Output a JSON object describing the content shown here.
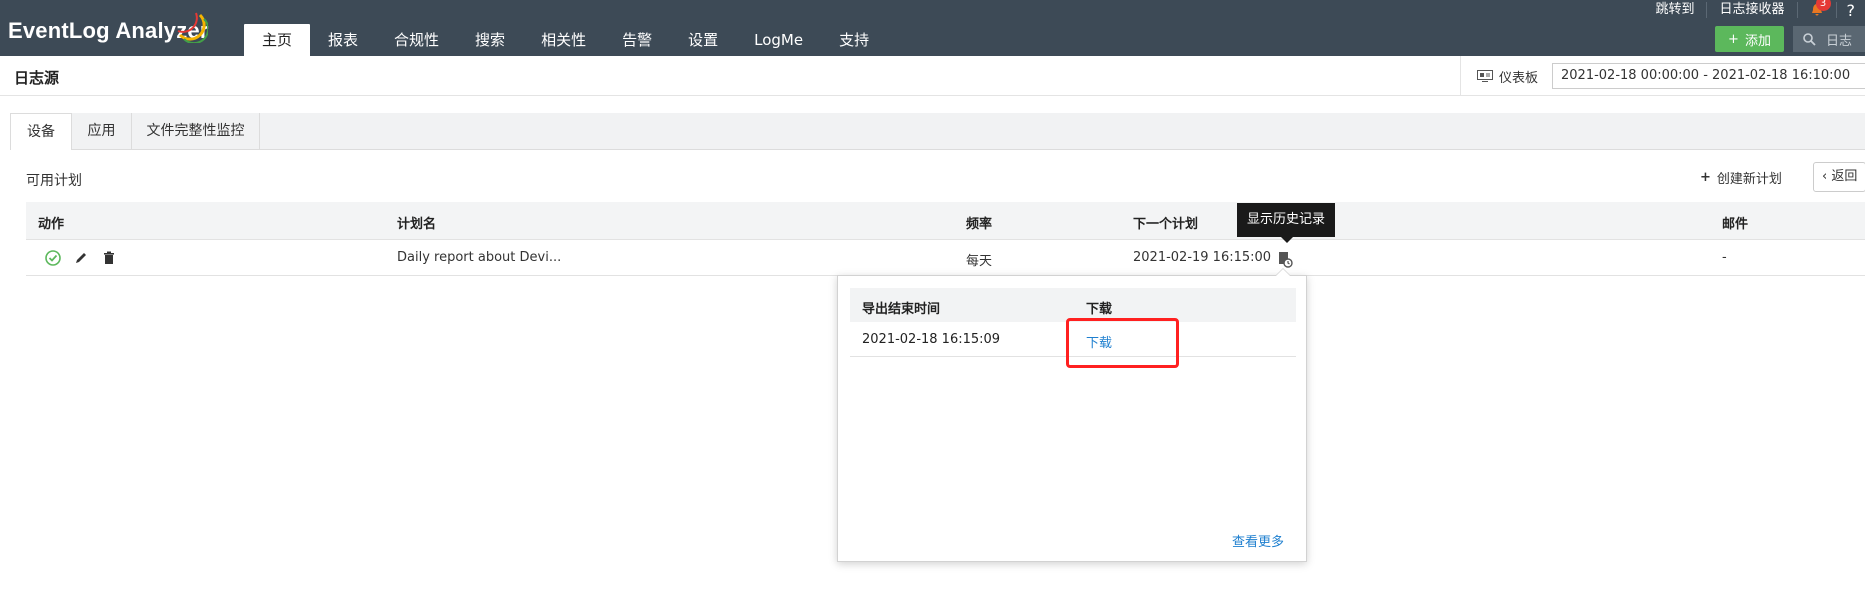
{
  "app": {
    "logo_text": "EventLog Analyzer",
    "nav": [
      "主页",
      "报表",
      "合规性",
      "搜索",
      "相关性",
      "告警",
      "设置",
      "LogMe",
      "支持"
    ],
    "active_nav": "主页",
    "top_links": {
      "jump_to": "跳转到",
      "log_receiver": "日志接收器",
      "notification_count": "3",
      "help": "?"
    },
    "add_label": "添加",
    "search_placeholder": "日志"
  },
  "subheader": {
    "title": "日志源",
    "dashboard": "仪表板",
    "date_range": "2021-02-18 00:00:00 - 2021-02-18 16:10:00"
  },
  "tabs": [
    "设备",
    "应用",
    "文件完整性监控"
  ],
  "content": {
    "available_plans": "可用计划",
    "create_plan": "创建新计划",
    "back": "返回"
  },
  "table": {
    "headers": {
      "action": "动作",
      "plan_name": "计划名",
      "frequency": "频率",
      "next_schedule": "下一个计划",
      "email": "邮件"
    },
    "rows": [
      {
        "plan_name": "Daily report about Devi...",
        "frequency": "每天",
        "next_schedule": "2021-02-19 16:15:00",
        "email": "-"
      }
    ]
  },
  "tooltip": "显示历史记录",
  "history_popup": {
    "headers": {
      "export_end_time": "导出结束时间",
      "download": "下载"
    },
    "rows": [
      {
        "export_end_time": "2021-02-18 16:15:09",
        "download": "下载"
      }
    ],
    "view_more": "查看更多"
  },
  "colors": {
    "topbar": "#3d4a56",
    "add_button": "#5cb85c",
    "link": "#1e7fcf",
    "highlight": "#ff2020"
  }
}
